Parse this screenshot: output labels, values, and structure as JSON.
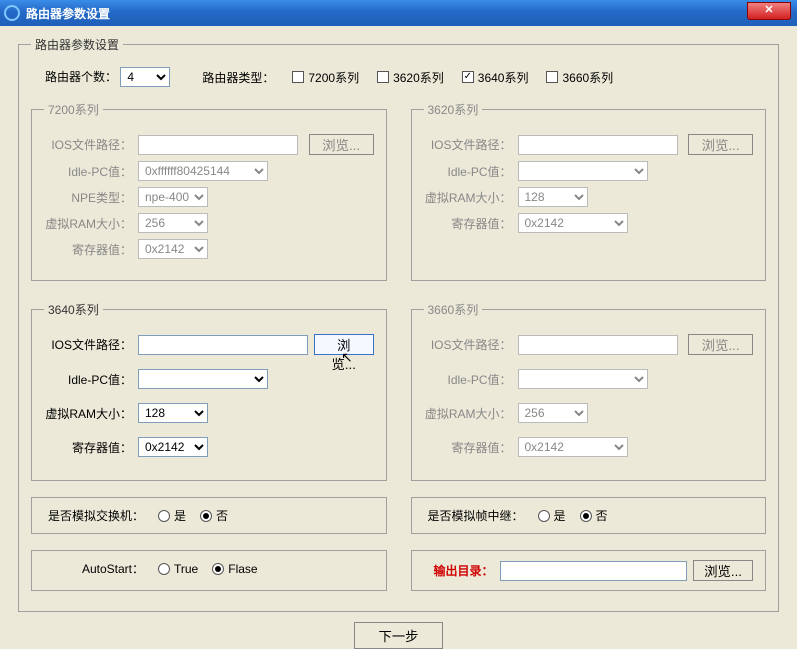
{
  "window": {
    "title": "路由器参数设置",
    "closeGlyph": "✕"
  },
  "main": {
    "legend": "路由器参数设置",
    "routerCountLabel": "路由器个数：",
    "routerCountValue": "4",
    "routerTypeLabel": "路由器类型：",
    "types": {
      "s7200": {
        "label": "7200系列",
        "checked": false
      },
      "s3620": {
        "label": "3620系列",
        "checked": false
      },
      "s3640": {
        "label": "3640系列",
        "checked": true
      },
      "s3660": {
        "label": "3660系列",
        "checked": false
      }
    }
  },
  "panels": {
    "browseBtn": "浏览...",
    "iosLabel": "IOS文件路径：",
    "idlePCLabel": "Idle-PC值：",
    "npeLabel": "NPE类型：",
    "ramLabel": "虚拟RAM大小：",
    "regLabel": "寄存器值：",
    "p7200": {
      "legend": "7200系列",
      "ios": "",
      "idlePC": "0xffffff80425144",
      "npe": "npe-400",
      "ram": "256",
      "reg": "0x2142"
    },
    "p3620": {
      "legend": "3620系列",
      "ios": "",
      "idlePC": "",
      "ram": "128",
      "reg": "0x2142"
    },
    "p3640": {
      "legend": "3640系列",
      "ios": "",
      "idlePC": "",
      "ram": "128",
      "reg": "0x2142"
    },
    "p3660": {
      "legend": "3660系列",
      "ios": "",
      "idlePC": "",
      "ram": "256",
      "reg": "0x2142"
    }
  },
  "switchSim": {
    "label": "是否模拟交换机：",
    "yes": "是",
    "no": "否",
    "selected": "no"
  },
  "frameRelay": {
    "label": "是否模拟帧中继：",
    "yes": "是",
    "no": "否",
    "selected": "no"
  },
  "autostart": {
    "label": "AutoStart：",
    "trueLabel": "True",
    "falseLabel": "Flase",
    "selected": "false"
  },
  "output": {
    "label": "输出目录：",
    "value": "",
    "browse": "浏览..."
  },
  "footer": {
    "next": "下一步"
  }
}
